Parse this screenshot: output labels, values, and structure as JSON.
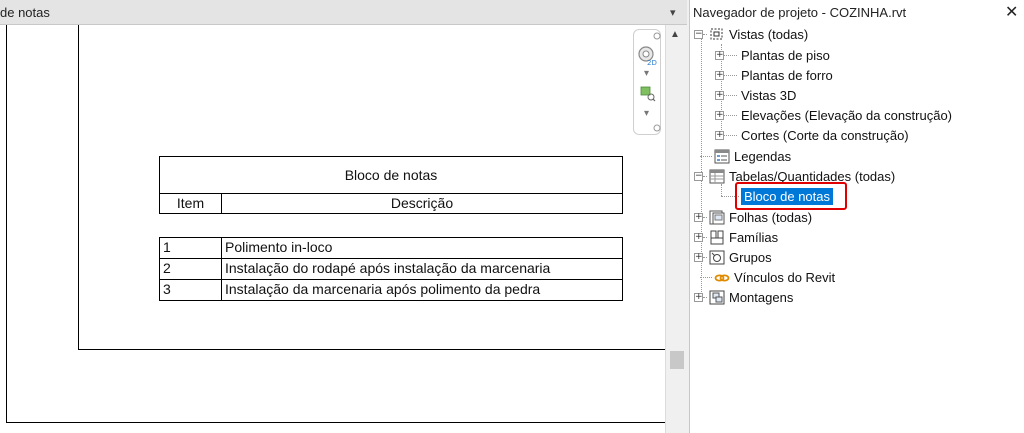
{
  "view_pane": {
    "title": "de notas",
    "pin_glyph": "▾",
    "schedule": {
      "title": "Bloco de notas",
      "headers": [
        "Item",
        "Descrição"
      ],
      "rows": [
        {
          "item": "1",
          "description": "Polimento in-loco"
        },
        {
          "item": "2",
          "description": "Instalação do rodapé após instalação da marcenaria"
        },
        {
          "item": "3",
          "description": "Instalação da marcenaria após polimento da pedra"
        }
      ]
    },
    "nav_bar": {
      "icons": [
        "2d-wheel-icon",
        "zoom-region-icon"
      ]
    },
    "scroll_up_glyph": "▲"
  },
  "project_browser": {
    "title": "Navegador de projeto - COZINHA.rvt",
    "close_glyph": "✕",
    "tree": {
      "views": "Vistas (todas)",
      "floor_plans": "Plantas de piso",
      "ceiling_plans": "Plantas de forro",
      "views_3d": "Vistas 3D",
      "elevations": "Elevações (Elevação da construção)",
      "sections": "Cortes (Corte da construção)",
      "legends": "Legendas",
      "schedules": "Tabelas/Quantidades (todas)",
      "schedule_item": "Bloco de notas",
      "sheets": "Folhas (todas)",
      "families": "Famílias",
      "groups": "Grupos",
      "revit_links": "Vínculos do Revit",
      "assemblies": "Montagens"
    },
    "expander_collapsed": "+",
    "expander_expanded": "−"
  },
  "colors": {
    "selection": "#0078d7",
    "highlight_box": "#e00000"
  }
}
